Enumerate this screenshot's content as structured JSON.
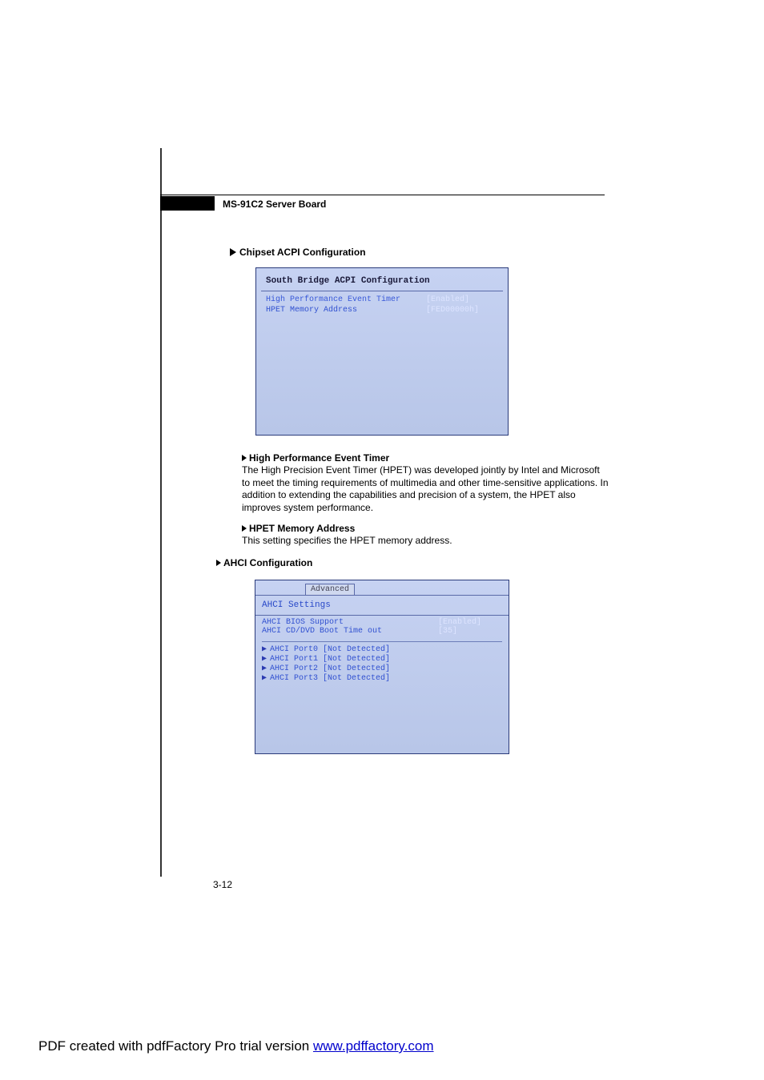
{
  "header": {
    "title": "MS-91C2 Server Board"
  },
  "section1": {
    "heading": "Chipset ACPI Configuration"
  },
  "bios1": {
    "title": "South Bridge ACPI Configuration",
    "rows": [
      {
        "label": "High Performance Event Timer",
        "value": "[Enabled]"
      },
      {
        "label": "HPET Memory Address",
        "value": "[FED00000h]"
      }
    ]
  },
  "hpet": {
    "heading": "High Performance Event Timer",
    "paragraph": "The High Precision Event Timer (HPET) was developed jointly by Intel and Microsoft to meet the timing requirements of multimedia and other time-sensitive applications. In addition to extending the capabilities and precision of a system, the HPET also improves system performance."
  },
  "hpetmem": {
    "heading": "HPET Memory Address",
    "paragraph": "This setting specifies the HPET memory address."
  },
  "ahci": {
    "heading": "AHCI Configuration"
  },
  "bios2": {
    "tab": "Advanced",
    "title": "AHCI Settings",
    "rows": [
      {
        "label": "AHCI BIOS Support",
        "value": "[Enabled]"
      },
      {
        "label": "AHCI CD/DVD Boot Time out",
        "value": "[35]"
      }
    ],
    "ports": [
      "AHCI Port0 [Not Detected]",
      "AHCI Port1 [Not Detected]",
      "AHCI Port2 [Not Detected]",
      "AHCI Port3 [Not Detected]"
    ]
  },
  "page_number": "3-12",
  "footer": {
    "prefix": "PDF created with pdfFactory Pro trial version ",
    "link_text": "www.pdffactory.com"
  }
}
